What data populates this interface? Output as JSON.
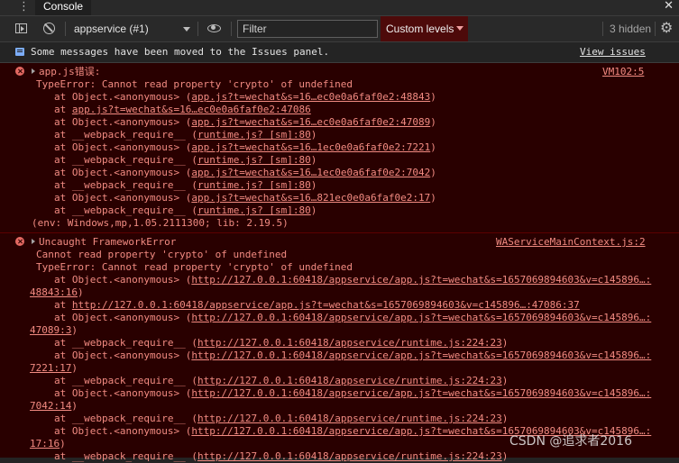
{
  "tabs": {
    "active_label": "Console",
    "more_icon": "kebab-icon",
    "close_icon": "close-icon"
  },
  "toolbar": {
    "context": "appservice (#1)",
    "filter_placeholder": "Filter",
    "levels_label": "Custom levels",
    "hidden_count": "3 hidden",
    "levels_bg": "#4d0a0a"
  },
  "info": {
    "text": "Some messages have been moved to the Issues panel.",
    "link": "View issues"
  },
  "error1": {
    "title": "app.js错误:",
    "source": "VM102:5",
    "message": "TypeError: Cannot read property 'crypto' of undefined",
    "stack": [
      {
        "prefix": "at Object.<anonymous> (",
        "link": "app.js?t=wechat&s=16…ec0e0a6faf0e2:48843",
        "suffix": ")"
      },
      {
        "prefix": "at ",
        "link": "app.js?t=wechat&s=16…ec0e0a6faf0e2:47086",
        "suffix": ""
      },
      {
        "prefix": "at Object.<anonymous> (",
        "link": "app.js?t=wechat&s=16…ec0e0a6faf0e2:47089",
        "suffix": ")"
      },
      {
        "prefix": "at __webpack_require__ (",
        "link": "runtime.js? [sm]:80",
        "suffix": ")"
      },
      {
        "prefix": "at Object.<anonymous> (",
        "link": "app.js?t=wechat&s=16…1ec0e0a6faf0e2:7221",
        "suffix": ")"
      },
      {
        "prefix": "at __webpack_require__ (",
        "link": "runtime.js? [sm]:80",
        "suffix": ")"
      },
      {
        "prefix": "at Object.<anonymous> (",
        "link": "app.js?t=wechat&s=16…1ec0e0a6faf0e2:7042",
        "suffix": ")"
      },
      {
        "prefix": "at __webpack_require__ (",
        "link": "runtime.js? [sm]:80",
        "suffix": ")"
      },
      {
        "prefix": "at Object.<anonymous> (",
        "link": "app.js?t=wechat&s=16…821ec0e0a6faf0e2:17",
        "suffix": ")"
      },
      {
        "prefix": "at __webpack_require__ (",
        "link": "runtime.js? [sm]:80",
        "suffix": ")"
      }
    ],
    "env": "(env: Windows,mp,1.05.2111300; lib: 2.19.5)"
  },
  "error2": {
    "title": "Uncaught FrameworkError",
    "source": "WAServiceMainContext.js:2",
    "message1": "Cannot read property 'crypto' of undefined",
    "message2": "TypeError: Cannot read property 'crypto' of undefined",
    "lines": [
      {
        "indent": "stack",
        "prefix": "at Object.<anonymous> (",
        "link": "http://127.0.0.1:60418/appservice/app.js?t=wechat&s=1657069894603&v=c145896…:",
        "suffix": ""
      },
      {
        "indent": "none",
        "prefix": "",
        "link": "48843:16",
        "suffix": ")"
      },
      {
        "indent": "stack",
        "prefix": "at ",
        "link": "http://127.0.0.1:60418/appservice/app.js?t=wechat&s=1657069894603&v=c145896…:47086:37",
        "suffix": ""
      },
      {
        "indent": "stack",
        "prefix": "at Object.<anonymous> (",
        "link": "http://127.0.0.1:60418/appservice/app.js?t=wechat&s=1657069894603&v=c145896…:",
        "suffix": ""
      },
      {
        "indent": "none",
        "prefix": "",
        "link": "47089:3",
        "suffix": ")"
      },
      {
        "indent": "stack",
        "prefix": "at __webpack_require__ (",
        "link": "http://127.0.0.1:60418/appservice/runtime.js:224:23",
        "suffix": ")"
      },
      {
        "indent": "stack",
        "prefix": "at Object.<anonymous> (",
        "link": "http://127.0.0.1:60418/appservice/app.js?t=wechat&s=1657069894603&v=c145896…:",
        "suffix": ""
      },
      {
        "indent": "none",
        "prefix": "",
        "link": "7221:17",
        "suffix": ")"
      },
      {
        "indent": "stack",
        "prefix": "at __webpack_require__ (",
        "link": "http://127.0.0.1:60418/appservice/runtime.js:224:23",
        "suffix": ")"
      },
      {
        "indent": "stack",
        "prefix": "at Object.<anonymous> (",
        "link": "http://127.0.0.1:60418/appservice/app.js?t=wechat&s=1657069894603&v=c145896…:",
        "suffix": ""
      },
      {
        "indent": "none",
        "prefix": "",
        "link": "7042:14",
        "suffix": ")"
      },
      {
        "indent": "stack",
        "prefix": "at __webpack_require__ (",
        "link": "http://127.0.0.1:60418/appservice/runtime.js:224:23",
        "suffix": ")"
      },
      {
        "indent": "stack",
        "prefix": "at Object.<anonymous> (",
        "link": "http://127.0.0.1:60418/appservice/app.js?t=wechat&s=1657069894603&v=c145896…:",
        "suffix": ""
      },
      {
        "indent": "none",
        "prefix": "",
        "link": "17:16",
        "suffix": ")"
      },
      {
        "indent": "stack",
        "prefix": "at __webpack_require__ (",
        "link": "http://127.0.0.1:60418/appservice/runtime.js:224:23",
        "suffix": ")"
      }
    ]
  },
  "watermark": "CSDN @追求者2016",
  "colors": {
    "error_bg": "#290000",
    "error_text": "#f28b82",
    "panel_bg": "#242424",
    "info_icon": "#7cacf8"
  }
}
